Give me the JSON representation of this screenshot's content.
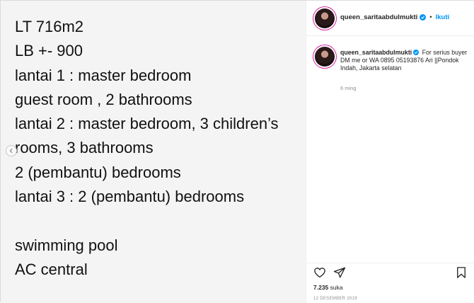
{
  "post": {
    "lines": [
      "LT 716m2",
      "LB +- 900",
      "lantai 1 : master bedroom",
      "guest room , 2 bathrooms",
      "lantai 2 : master bedroom, 3 children’s",
      "rooms, 3 bathrooms",
      "2  (pembantu) bedrooms",
      "lantai 3 : 2 (pembantu) bedrooms",
      "",
      "swimming pool",
      "AC central"
    ]
  },
  "header": {
    "username": "queen_saritaabdulmukti",
    "separator": "•",
    "follow_label": "Ikuti"
  },
  "caption": {
    "username": "queen_saritaabdulmukti",
    "text": "For serius buyer DM me or WA 0895 05193876 Ari ||Pondok Indah, Jakarta selatan",
    "time_ago": "6 ming"
  },
  "stats": {
    "likes_count": "7.235",
    "likes_label": "suka",
    "date": "12 DESEMBER 2019"
  },
  "colors": {
    "accent": "#0095f6",
    "text": "#262626",
    "muted": "#8e8e8e"
  },
  "icons": [
    "chevron-left-icon",
    "verified-badge-icon",
    "heart-icon",
    "share-icon",
    "bookmark-icon"
  ]
}
